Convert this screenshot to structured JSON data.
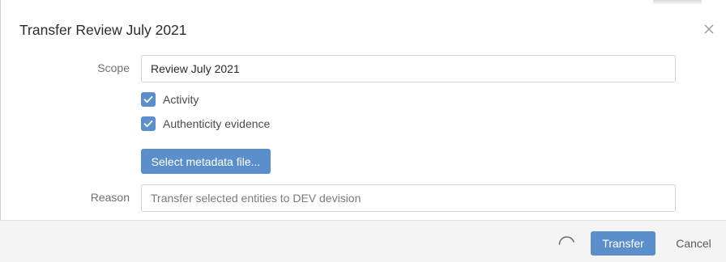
{
  "dialog": {
    "title": "Transfer Review July 2021",
    "close_icon": "close-icon"
  },
  "form": {
    "scope_label": "Scope",
    "scope_value": "Review July 2021",
    "checkboxes": [
      {
        "label": "Activity",
        "checked": true
      },
      {
        "label": "Authenticity evidence",
        "checked": true
      }
    ],
    "metadata_button": "Select metadata file...",
    "reason_label": "Reason",
    "reason_placeholder": "Transfer selected entities to DEV devision"
  },
  "footer": {
    "spinner_icon": "loading-spinner-icon",
    "transfer_button": "Transfer",
    "cancel_button": "Cancel"
  },
  "colors": {
    "accent": "#5b8fcb",
    "footer_bg": "#f4f4f4"
  }
}
